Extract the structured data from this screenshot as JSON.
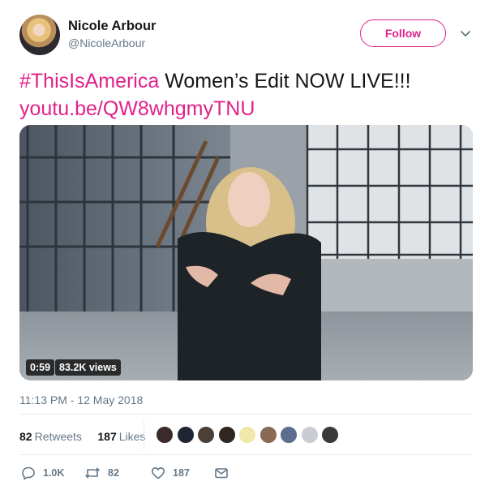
{
  "author": {
    "name": "Nicole Arbour",
    "handle": "@NicoleArbour"
  },
  "follow_label": "Follow",
  "tweet": {
    "hashtag": "#ThisIsAmerica",
    "text": " Women’s Edit NOW LIVE!!!",
    "link": "youtu.be/QW8whgmyTNU"
  },
  "video": {
    "duration": "0:59",
    "views": "83.2K views"
  },
  "timestamp": "11:13 PM - 12 May 2018",
  "stats": {
    "retweets_count": "82",
    "retweets_label": "Retweets",
    "likes_count": "187",
    "likes_label": "Likes"
  },
  "likers": [
    "#3b2a2a",
    "#1f2533",
    "#4a4038",
    "#2e2721",
    "#f0e8a8",
    "#8a6a55",
    "#5b6e8f",
    "#c9ccd3",
    "#3a3a3a"
  ],
  "actions": {
    "replies": "1.0K",
    "retweets": "82",
    "likes": "187"
  },
  "colors": {
    "accent": "#e0218a",
    "muted": "#657786",
    "text": "#14171a"
  }
}
